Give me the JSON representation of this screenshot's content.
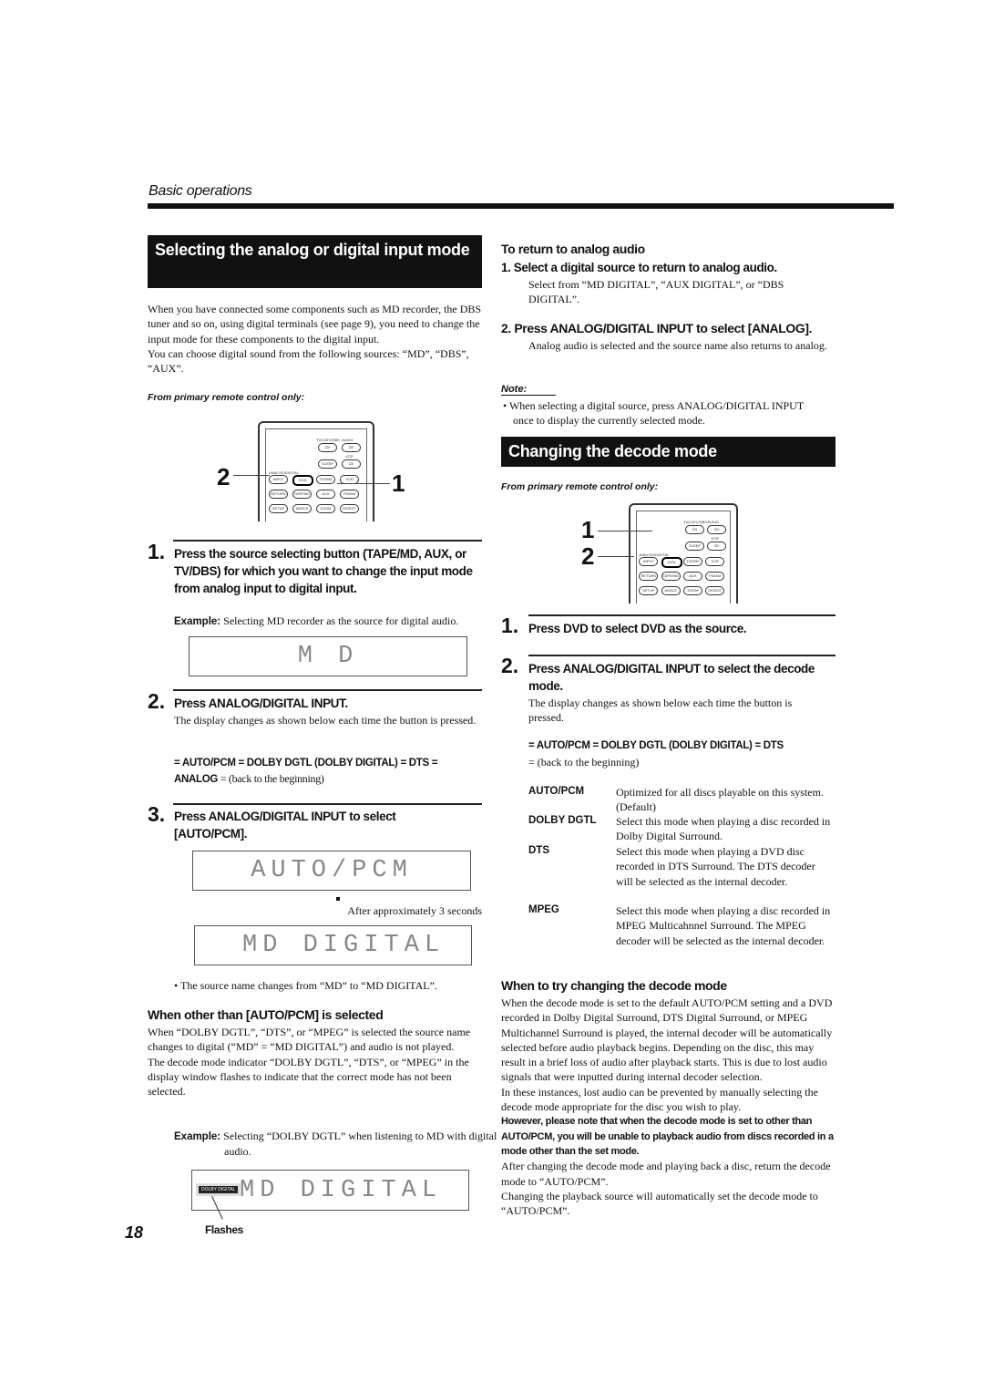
{
  "header": {
    "section": "Basic operations"
  },
  "page_number": "18",
  "left": {
    "title": "Selecting the analog or digital input mode",
    "intro": [
      "When you have connected some components such as MD recorder,  the DBS tuner and so on, using digital terminals (see page 9), you need to change the input mode for these components to the digital input.",
      "You can choose digital sound from the following sources: “MD”, “DBS”, “AUX”."
    ],
    "remote_note": "From primary remote control only:",
    "callouts": [
      "2",
      "1"
    ],
    "step1": {
      "num": "1.",
      "text": "Press the source selecting button (TAPE/MD, AUX, or TV/DBS) for which you want to change the input mode from analog input to digital input.",
      "example_label": "Example:",
      "example": "Selecting MD recorder as the source for digital audio.",
      "display": "M D"
    },
    "step2": {
      "num": "2.",
      "text": "Press ANALOG/DIGITAL INPUT.",
      "desc": "The display changes as shown below each time the button is pressed.",
      "seq_line1": "=  AUTO/PCM =   DOLBY DGTL (DOLBY DIGITAL) =   DTS =",
      "seq_line2_bold": "ANALOG",
      "seq_line2_rest": " =   (back to the beginning)"
    },
    "step3": {
      "num": "3.",
      "text": "Press ANALOG/DIGITAL INPUT to select [AUTO/PCM].",
      "display1": "AUTO/PCM",
      "after": "After approximately 3 seconds",
      "display2": "MD  DIGITAL"
    },
    "bullet": "The source name changes from “MD” to “MD DIGITAL”.",
    "other": {
      "heading": "When other than [AUTO/PCM] is selected",
      "p1": "When “DOLBY DGTL”, “DTS”, or  “MPEG” is selected the source name changes to digital (“MD” =  “MD DIGITAL”) and audio is not played.",
      "p2": "The decode mode indicator “DOLBY DGTL”, “DTS”, or “MPEG” in the display window flashes to indicate that the correct mode has not been selected.",
      "example_label": "Example:",
      "example": "Selecting “DOLBY DGTL” when listening to MD with digital audio.",
      "display": "MD  DIGITAL",
      "indicator": "DOLBY DIGITAL",
      "flashes": "Flashes"
    }
  },
  "remote_labels": {
    "tv": "TV/CATV/DBS",
    "audio": "AUDIO",
    "vcr_top": "VCR",
    "sleep": "SLEEP",
    "analog": "ANALOG/DIGITAL",
    "buttons": [
      "INPUT",
      "DVD",
      "TV/DBS",
      "VCR",
      "RETURN",
      "TAPE/MD",
      "AUX",
      "FM/AM",
      "SETUP",
      "ANGLE",
      "ZOOM",
      "DIGEST"
    ],
    "power": "⏻/I"
  },
  "right": {
    "return": {
      "heading": "To return to analog audio",
      "s1": "1.  Select a digital source to return to analog audio.",
      "s1_desc": "Select from “MD DIGITAL”, “AUX DIGITAL”, or “DBS DIGITAL”.",
      "s2": "2.  Press ANALOG/DIGITAL INPUT to select [ANALOG].",
      "s2_desc": "Analog audio is selected and the source name also returns to analog."
    },
    "note": {
      "label": "Note:",
      "text": "When selecting a digital source, press ANALOG/DIGITAL INPUT once to display the currently selected mode."
    },
    "title": "Changing the decode mode",
    "remote_note": "From primary remote control only:",
    "callouts": [
      "1",
      "2"
    ],
    "step1": {
      "num": "1.",
      "text": "Press DVD to select DVD as the source."
    },
    "step2": {
      "num": "2.",
      "text": "Press ANALOG/DIGITAL INPUT to select the decode mode.",
      "desc": "The display changes as shown below each time the button is pressed.",
      "seq_line1": "=  AUTO/PCM =   DOLBY DGTL (DOLBY DIGITAL) =   DTS",
      "seq_line2": "=   (back to the beginning)"
    },
    "modes": [
      {
        "term": "AUTO/PCM",
        "desc": "Optimized for all discs playable on this system. (Default)"
      },
      {
        "term": "DOLBY DGTL",
        "desc": "Select this mode when playing a disc recorded in Dolby Digital Surround."
      },
      {
        "term": "DTS",
        "desc": "Select this mode when playing a DVD disc recorded in DTS Surround. The DTS decoder will be selected as the internal decoder."
      },
      {
        "term": "MPEG",
        "desc": "Select this mode when playing a disc recorded in MPEG Multicahnnel Surround. The MPEG decoder will be selected as the internal decoder."
      }
    ],
    "try": {
      "heading": "When to try changing the decode mode",
      "p1": "When the decode mode is set to the default AUTO/PCM setting and a DVD recorded in Dolby Digital Surround, DTS Digital Surround, or MPEG Multichannel Surround is played, the internal decoder will be automatically selected before audio playback begins.  Depending on the disc, this may result in a brief loss of audio after playback starts.  This is due to lost audio signals that were inputted during internal decoder selection.",
      "p2": "In these instances, lost audio can be prevented by manually selecting the decode mode appropriate for the disc you wish to play.",
      "p3_bold": "However, please note that when the decode mode is set to other than AUTO/PCM, you will be unable to playback audio from discs recorded in a mode other than the set mode.",
      "p4": "After changing the decode mode and playing back a disc, return the decode mode to “AUTO/PCM”.",
      "p5": "Changing the playback source will automatically set the decode mode to “AUTO/PCM”."
    }
  }
}
